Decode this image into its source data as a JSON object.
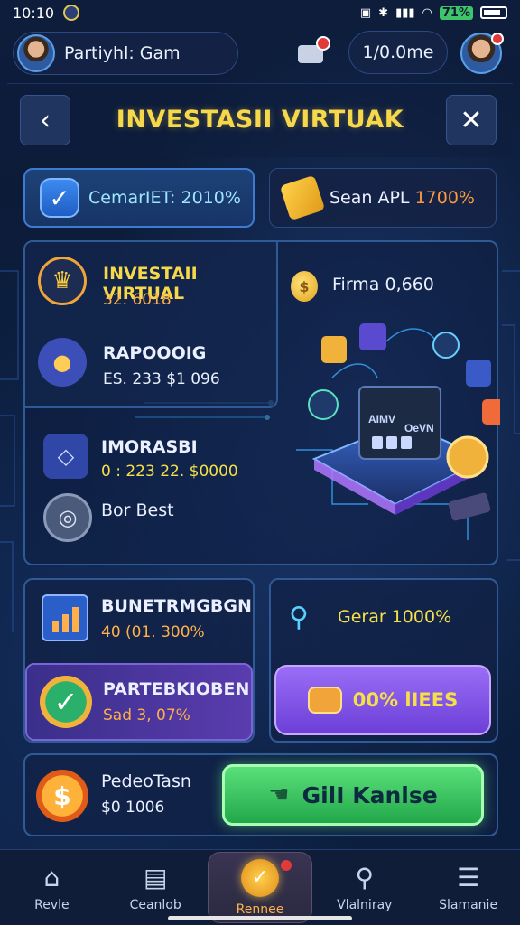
{
  "status_bar": {
    "time": "10:10",
    "battery_pct": "71%"
  },
  "top_bar": {
    "profile_name": "Partiyhl: Gam",
    "balance": "1/0.0me"
  },
  "header": {
    "title": "INVESTASII VIRTUAK"
  },
  "chips": [
    {
      "label": "CemarIET: 2010%",
      "icon": "check-shield-icon"
    },
    {
      "label": "Sean APL",
      "highlight": "1700%",
      "icon": "gold-ticket-icon"
    }
  ],
  "invest": {
    "primary": {
      "title": "INVESTAII VIRTUAL",
      "value": "32. 6018",
      "icon": "crown-icon"
    },
    "firma": {
      "label": "Firma 0,660",
      "coin": "$"
    },
    "secondary": {
      "title": "RAPOOOIG",
      "value": "ES. 233  $1 096",
      "icon": "gamepad-icon"
    },
    "third": {
      "title": "IMORASBI",
      "value": "0 : 223  22. $0000",
      "icon": "diamond-badge-icon"
    },
    "fourth": {
      "title": "Bor Best",
      "icon": "medal-icon"
    },
    "scene_labels": [
      "AIMV",
      "OeVN"
    ]
  },
  "budget": {
    "title": "BUNETRMGBGN",
    "value": "40 (01. 300%",
    "icon": "chart-icon"
  },
  "partner": {
    "title": "PARTEBKIOBEN",
    "value": "Sad 3, 07%",
    "icon": "verified-icon"
  },
  "gear": {
    "label": "Gerar 1000%",
    "button_label": "00% lIEES",
    "icon": "link-icon"
  },
  "bottom_card": {
    "title": "PedeoTasn",
    "value": "$0 1006",
    "button_label": "GilI Kanlse",
    "icon": "dollar-badge-icon"
  },
  "nav": [
    {
      "label": "Revle",
      "icon": "home-icon"
    },
    {
      "label": "Ceanlob",
      "icon": "document-icon"
    },
    {
      "label": "Rennee",
      "icon": "check-badge-icon",
      "active": true
    },
    {
      "label": "Vlalniray",
      "icon": "search-icon"
    },
    {
      "label": "Slamanie",
      "icon": "menu-icon"
    }
  ],
  "colors": {
    "accent_gold": "#f6d84a",
    "accent_green": "#5ae07a",
    "accent_purple": "#9a6ef6",
    "background": "#0b1a33",
    "panel_border": "#2f5a96"
  }
}
